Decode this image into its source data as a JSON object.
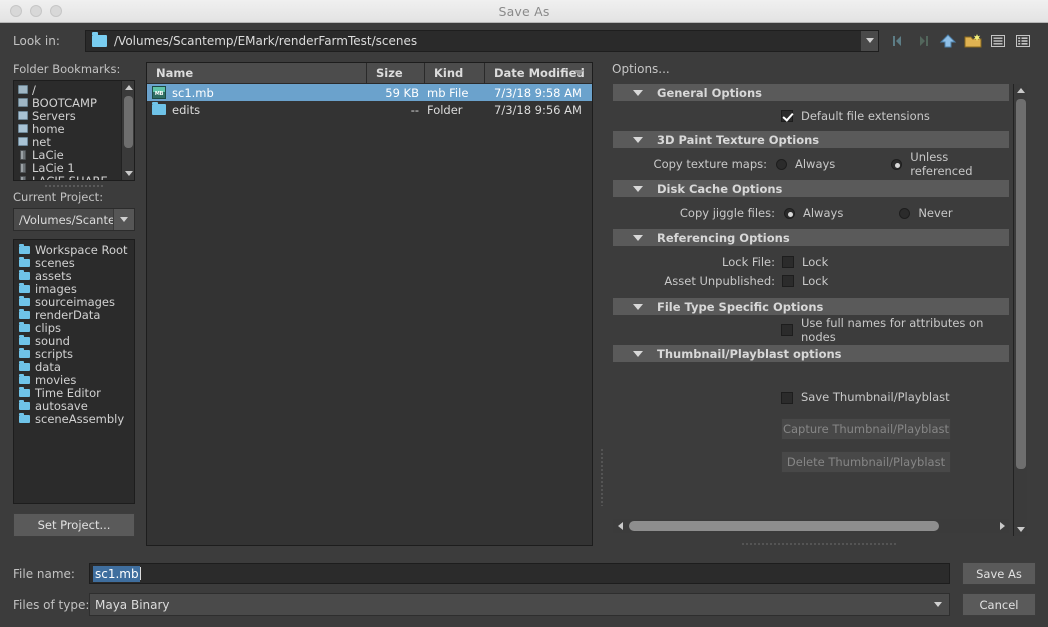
{
  "window": {
    "title": "Save As"
  },
  "lookin": {
    "label": "Look in:",
    "path": "/Volumes/Scantemp/EMark/renderFarmTest/scenes",
    "icons": [
      "back-icon",
      "forward-icon",
      "up-directory-icon",
      "new-folder-icon",
      "list-view-icon",
      "detail-view-icon"
    ]
  },
  "bookmarks": {
    "label": "Folder Bookmarks:",
    "items": [
      {
        "label": "/",
        "icon": "drive-icon"
      },
      {
        "label": "BOOTCAMP",
        "icon": "drive-icon"
      },
      {
        "label": "Servers",
        "icon": "network-icon"
      },
      {
        "label": "home",
        "icon": "network-icon"
      },
      {
        "label": "net",
        "icon": "network-icon"
      },
      {
        "label": "LaCie",
        "icon": "harddisk-icon"
      },
      {
        "label": "LaCie 1",
        "icon": "harddisk-icon"
      },
      {
        "label": "LACIE SHARE",
        "icon": "harddisk-icon"
      }
    ]
  },
  "project": {
    "label": "Current Project:",
    "value": "/Volumes/Scantem",
    "folders": [
      "Workspace Root",
      "scenes",
      "assets",
      "images",
      "sourceimages",
      "renderData",
      "clips",
      "sound",
      "scripts",
      "data",
      "movies",
      "Time Editor",
      "autosave",
      "sceneAssembly"
    ],
    "set_project_label": "Set Project..."
  },
  "filelist": {
    "columns": [
      "Name",
      "Size",
      "Kind",
      "Date Modified"
    ],
    "sorted_column": "Date Modified",
    "rows": [
      {
        "name": "sc1.mb",
        "size": "59 KB",
        "kind": "mb File",
        "date": "7/3/18 9:58 AM",
        "icon": "maya-binary-icon",
        "selected": true
      },
      {
        "name": "edits",
        "size": "--",
        "kind": "Folder",
        "date": "7/3/18 9:56 AM",
        "icon": "folder-icon",
        "selected": false
      }
    ]
  },
  "options": {
    "title": "Options...",
    "sections": [
      {
        "name": "General Options",
        "checkboxes": [
          {
            "label": "Default file extensions",
            "checked": true
          }
        ]
      },
      {
        "name": "3D Paint Texture Options",
        "radio_label": "Copy texture maps:",
        "radios": [
          {
            "label": "Always",
            "selected": false
          },
          {
            "label": "Unless referenced",
            "selected": true
          }
        ]
      },
      {
        "name": "Disk Cache Options",
        "radio_label": "Copy jiggle files:",
        "radios": [
          {
            "label": "Always",
            "selected": true
          },
          {
            "label": "Never",
            "selected": false
          }
        ]
      },
      {
        "name": "Referencing Options",
        "locks": [
          {
            "label": "Lock File:",
            "value": "Lock",
            "checked": false
          },
          {
            "label": "Asset Unpublished:",
            "value": "Lock",
            "checked": false
          }
        ]
      },
      {
        "name": "File Type Specific Options",
        "checkboxes": [
          {
            "label": "Use full names for attributes on nodes",
            "checked": false
          }
        ]
      },
      {
        "name": "Thumbnail/Playblast options",
        "checkboxes": [
          {
            "label": "Save Thumbnail/Playblast",
            "checked": false
          }
        ],
        "buttons": [
          {
            "label": "Capture Thumbnail/Playblast",
            "disabled": true
          },
          {
            "label": "Delete Thumbnail/Playblast",
            "disabled": true
          }
        ]
      }
    ]
  },
  "footer": {
    "filename_label": "File name:",
    "filename_value": "sc1.mb",
    "filetype_label": "Files of type:",
    "filetype_value": "Maya Binary",
    "save_label": "Save As",
    "cancel_label": "Cancel"
  },
  "colors": {
    "selection_blue": "#6ba2cc",
    "accent_folder": "#6fc3e8",
    "text_field_selection": "#3f6e9e"
  }
}
